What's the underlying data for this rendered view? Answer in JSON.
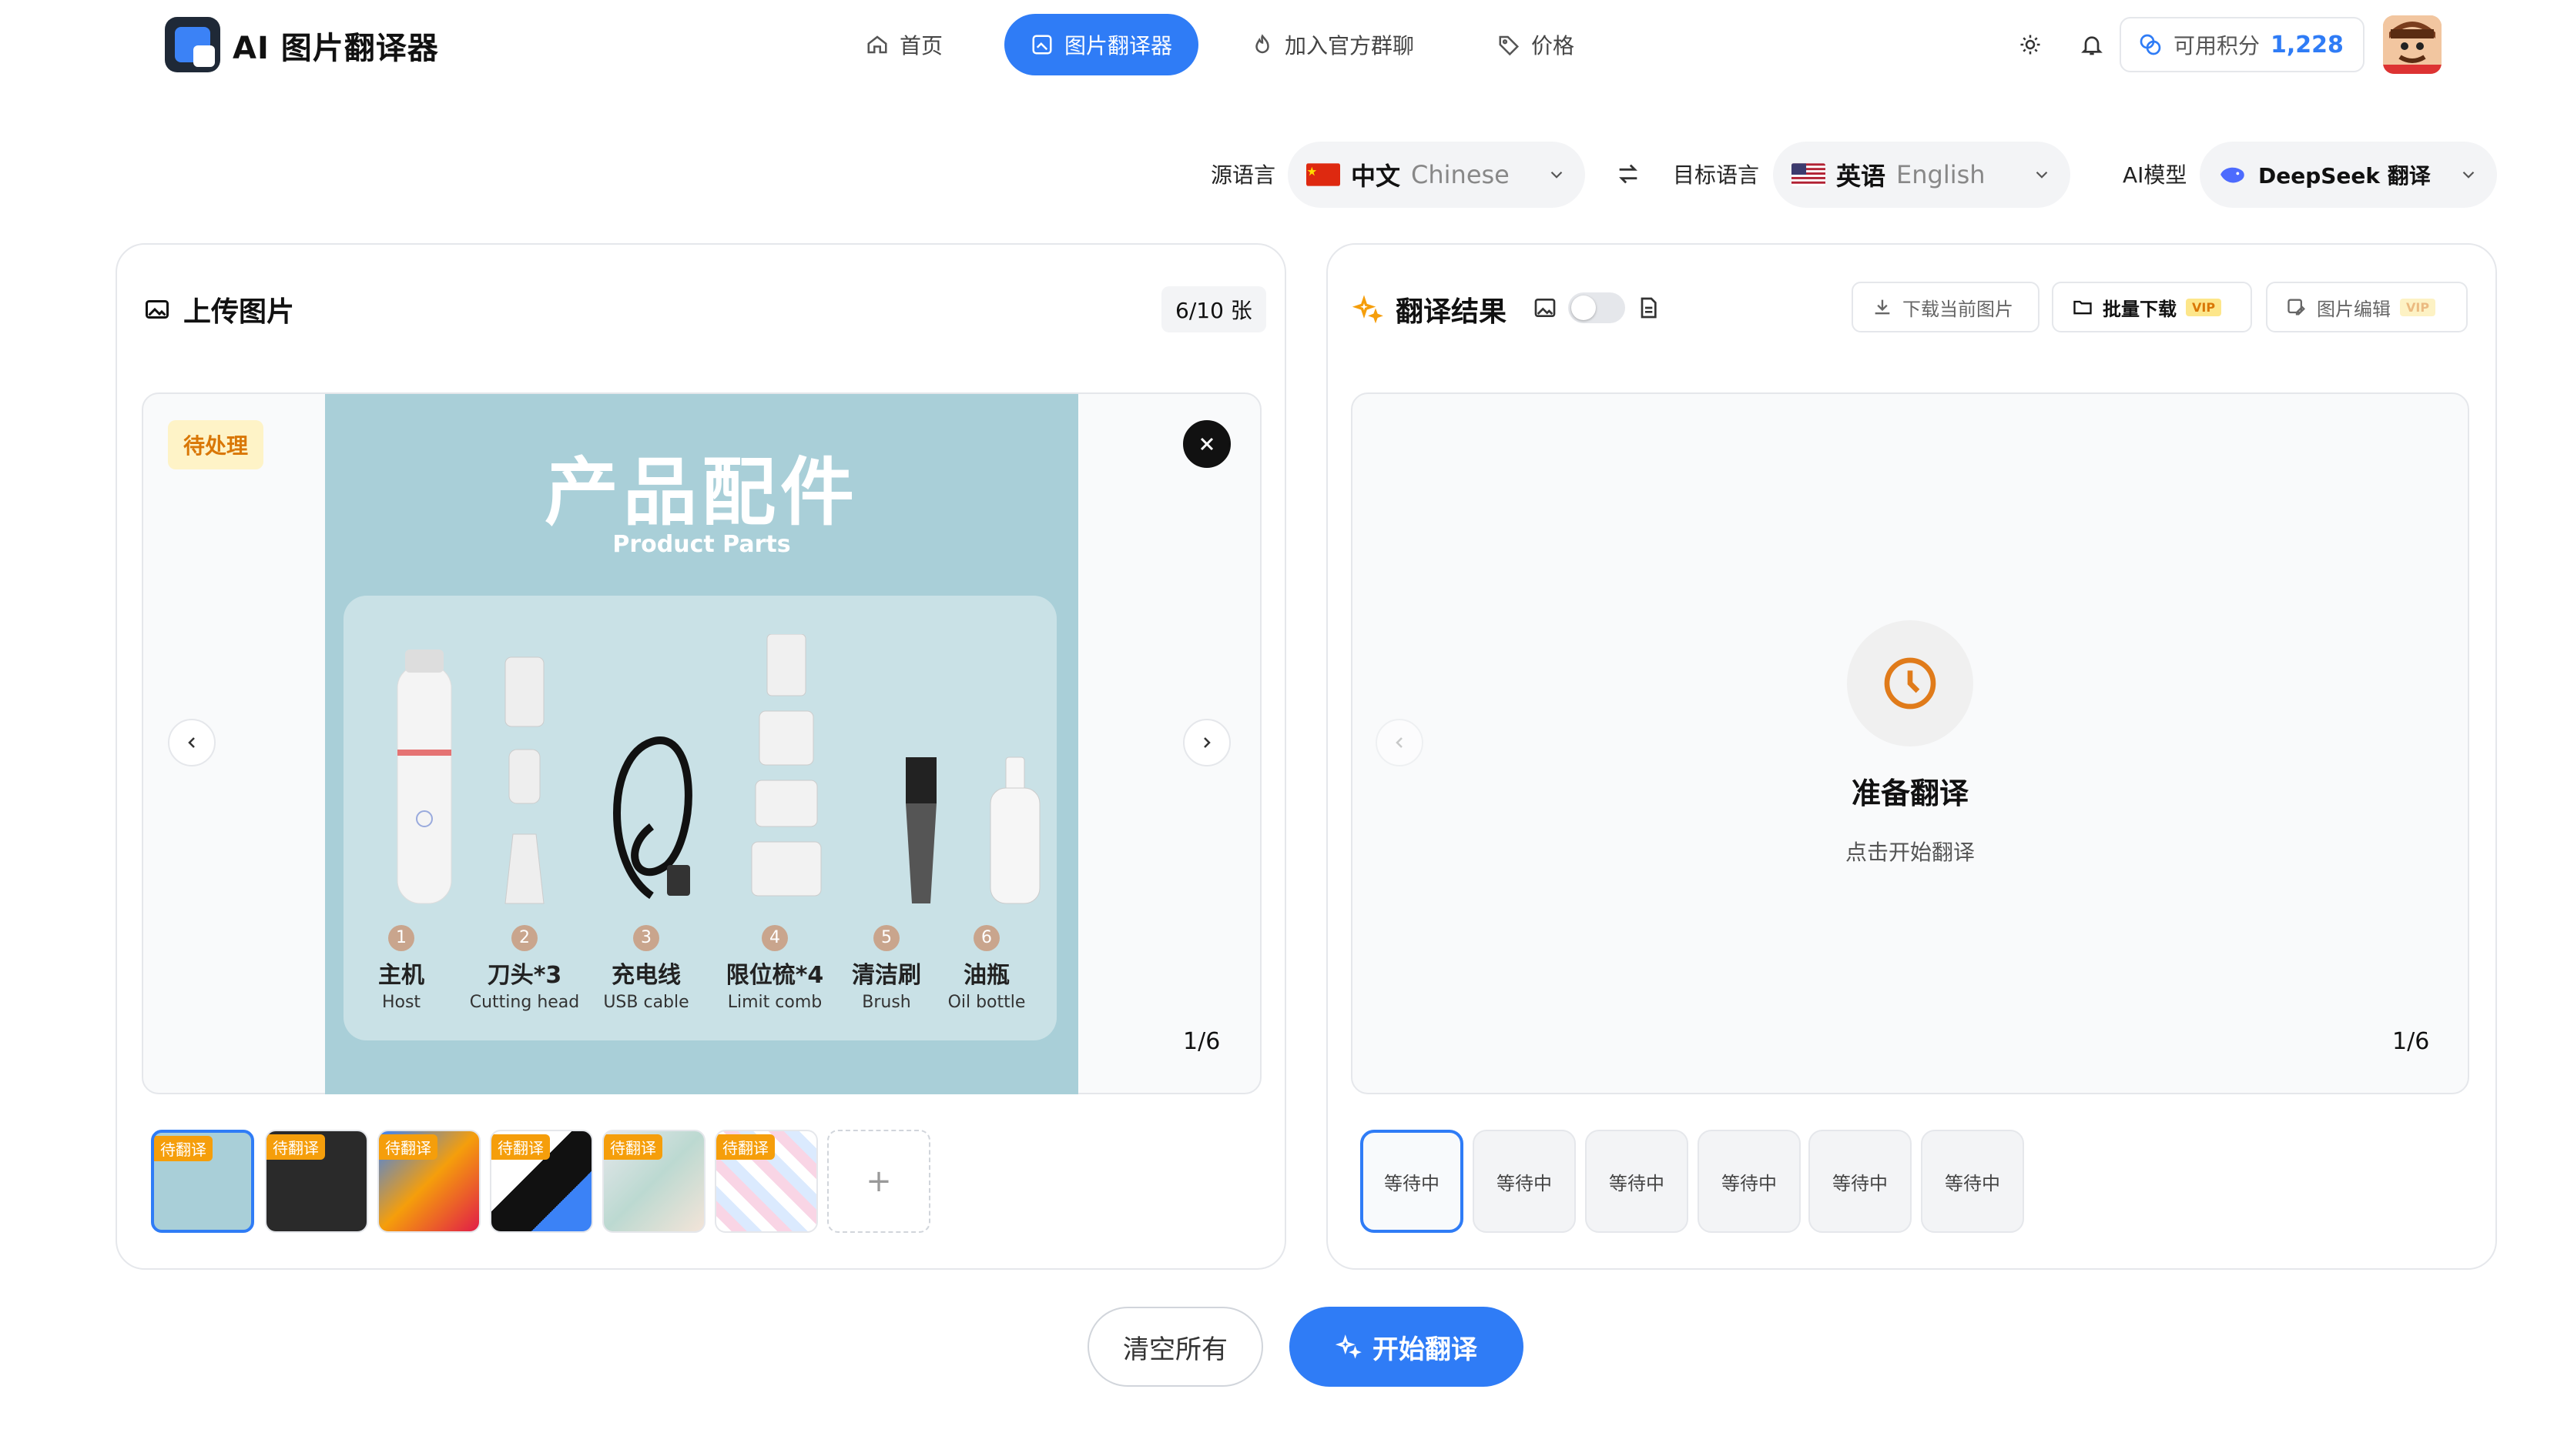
{
  "app": {
    "title": "AI 图片翻译器"
  },
  "nav": [
    {
      "label": "首页"
    },
    {
      "label": "图片翻译器"
    },
    {
      "label": "加入官方群聊"
    },
    {
      "label": "价格"
    }
  ],
  "credits": {
    "label": "可用积分",
    "value": "1,228"
  },
  "lang_bar": {
    "source_label": "源语言",
    "source": {
      "name": "中文",
      "sub": "Chinese"
    },
    "target_label": "目标语言",
    "target": {
      "name": "英语",
      "sub": "English"
    },
    "model_label": "AI模型",
    "model": "DeepSeek 翻译"
  },
  "upload_panel": {
    "title": "上传图片",
    "count": "6/10 张",
    "status": "待处理",
    "page": "1/6",
    "thumb_tag": "待翻译",
    "add": "+"
  },
  "product": {
    "title": "产品配件",
    "subtitle": "Product Parts",
    "parts": [
      {
        "num": "1",
        "cn": "主机",
        "en": "Host"
      },
      {
        "num": "2",
        "cn": "刀头*3",
        "en": "Cutting head"
      },
      {
        "num": "3",
        "cn": "充电线",
        "en": "USB cable"
      },
      {
        "num": "4",
        "cn": "限位梳*4",
        "en": "Limit comb"
      },
      {
        "num": "5",
        "cn": "清洁刷",
        "en": "Brush"
      },
      {
        "num": "6",
        "cn": "油瓶",
        "en": "Oil bottle"
      }
    ]
  },
  "result_panel": {
    "title": "翻译结果",
    "download_current": "下载当前图片",
    "batch_download": "批量下载",
    "edit_image": "图片编辑",
    "vip": "VIP",
    "ready_title": "准备翻译",
    "ready_sub": "点击开始翻译",
    "page": "1/6",
    "waiting": [
      "等待中",
      "等待中",
      "等待中",
      "等待中",
      "等待中",
      "等待中"
    ]
  },
  "actions": {
    "clear": "清空所有",
    "start": "开始翻译"
  },
  "colors": {
    "accent": "#2f7cf6",
    "pending": "#d97706",
    "clock": "#e07b1a"
  }
}
